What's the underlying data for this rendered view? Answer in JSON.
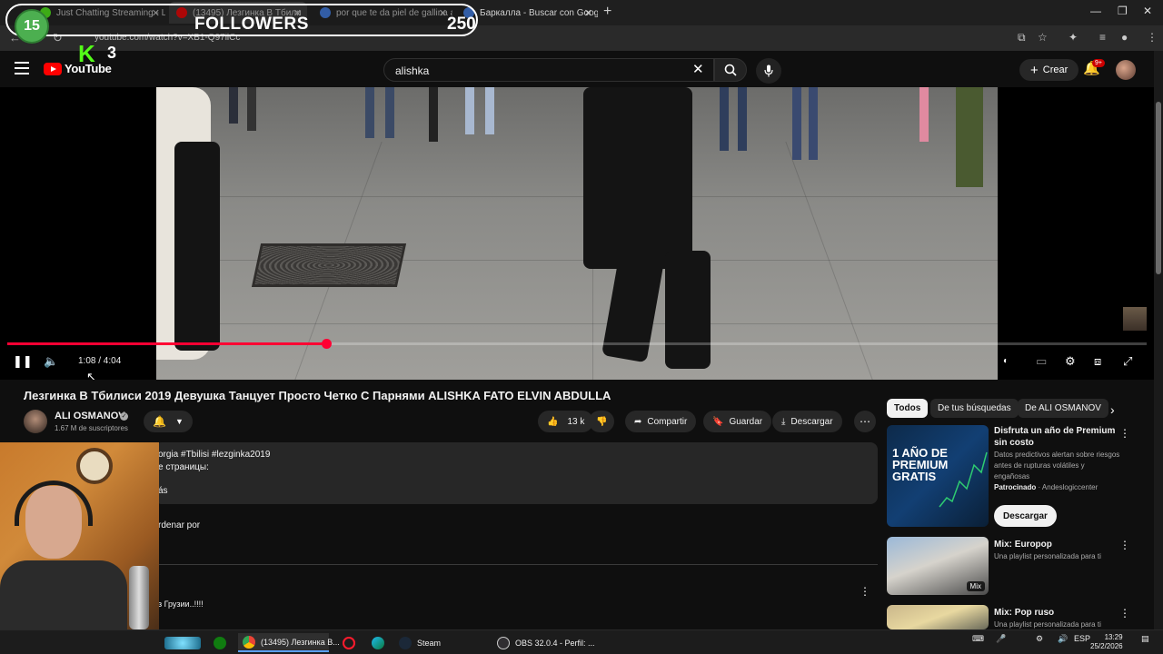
{
  "browser": {
    "tabs": [
      {
        "label": "Just Chatting Streaming - Live",
        "favicon_color": "#53fc18"
      },
      {
        "label": "(13495) Лезгинка В Тбили",
        "favicon_color": "#ff0000",
        "active": true
      },
      {
        "label": "por que te da piel de gallina al",
        "favicon_color": "#4285f4"
      },
      {
        "label": "Баркалла - Buscar con Google",
        "favicon_color": "#4285f4"
      }
    ],
    "new_tab": "+",
    "url": "youtube.com/watch?v=XB1-Q97ilCc"
  },
  "overlay": {
    "followers_count": "15",
    "followers_label": "FOLLOWERS",
    "followers_goal": "250",
    "kick_logo": "K",
    "kick_number": "3"
  },
  "youtube": {
    "logo_text": "YouTube",
    "search_value": "alishka",
    "create_label": "Crear",
    "notifications_badge": "9+"
  },
  "player": {
    "time": "1:08 / 4:04",
    "progress": 0.28
  },
  "video": {
    "title": "Лезгинка В Тбилиси 2019 Девушка Танцует Просто Четко С Парнями ALISHKA FATO ELVIN ABDULLA",
    "channel": "ALI OSMANOV",
    "subscribers": "1.67 M de suscriptores",
    "likes": "13 k",
    "share_label": "Compartir",
    "save_label": "Guardar",
    "download_label": "Descargar",
    "description_lines": [
      "orgia #Tbilisi #lezginka2019",
      "е страницы:",
      "ás"
    ],
    "sort_label": "rdenar por",
    "comment_text": "з Грузии..!!!!"
  },
  "sidebar": {
    "chips": [
      "Todos",
      "De tus búsquedas",
      "De ALI OSMANOV"
    ],
    "recommendations": [
      {
        "title": "Disfruta un año de Premium sin costo",
        "description": "Datos predictivos alertan sobre riesgos antes de rupturas volátiles y engañosas",
        "sponsor_label": "Patrocinado",
        "sponsor": "Andeslogiccenter",
        "button": "Descargar",
        "thumb_text": "1 AÑO DE PREMIUM GRATIS"
      },
      {
        "title": "Mix: Europop",
        "subtitle": "Una playlist personalizada para ti",
        "badge": "Mix"
      },
      {
        "title": "Mix: Pop ruso",
        "subtitle": "Una playlist personalizada para ti"
      }
    ]
  },
  "taskbar": {
    "items": [
      {
        "label": "(13495) Лезгинка В...",
        "color": "#4285f4"
      },
      {
        "label": "Steam",
        "color": "#1b2838"
      },
      {
        "label": "OBS 32.0.4 - Perfil: ...",
        "color": "#302e31"
      }
    ],
    "language": "ESP",
    "time": "13:29",
    "date": "25/2/2026"
  },
  "colors": {
    "accent": "#ff0033",
    "background": "#0f0f0f",
    "kick_green": "#53fc18"
  }
}
